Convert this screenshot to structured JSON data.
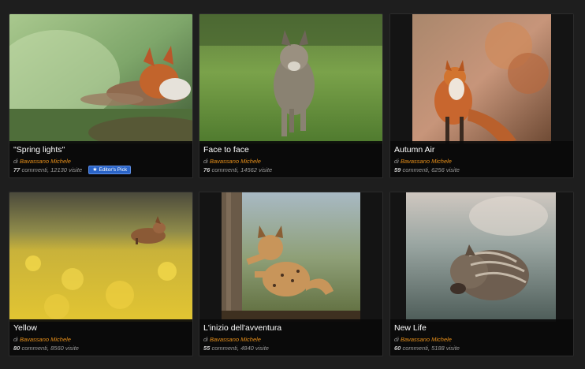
{
  "cards": [
    {
      "title": "\"Spring lights\"",
      "by": "di",
      "author": "Bavassano Michele",
      "comments": "77",
      "comments_label": "commenti,",
      "visits": "12130 visite",
      "badge": "Editor's Pick",
      "badge_icon": "star-icon"
    },
    {
      "title": "Face to face",
      "by": "di",
      "author": "Bavassano Michele",
      "comments": "76",
      "comments_label": "commenti,",
      "visits": "14562 visite"
    },
    {
      "title": "Autumn Air",
      "by": "di",
      "author": "Bavassano Michele",
      "comments": "59",
      "comments_label": "commenti,",
      "visits": "6256 visite"
    },
    {
      "title": "Yellow",
      "by": "di",
      "author": "Bavassano Michele",
      "comments": "80",
      "comments_label": "commenti,",
      "visits": "8560 visite"
    },
    {
      "title": "L'inizio dell'avventura",
      "by": "di",
      "author": "Bavassano Michele",
      "comments": "55",
      "comments_label": "commenti,",
      "visits": "4840 visite"
    },
    {
      "title": "New Life",
      "by": "di",
      "author": "Bavassano Michele",
      "comments": "60",
      "comments_label": "commenti,",
      "visits": "5188 visite"
    }
  ],
  "colors": {
    "author": "#e8901a",
    "badge": "#2a64c8",
    "background": "#1e1e1e"
  }
}
